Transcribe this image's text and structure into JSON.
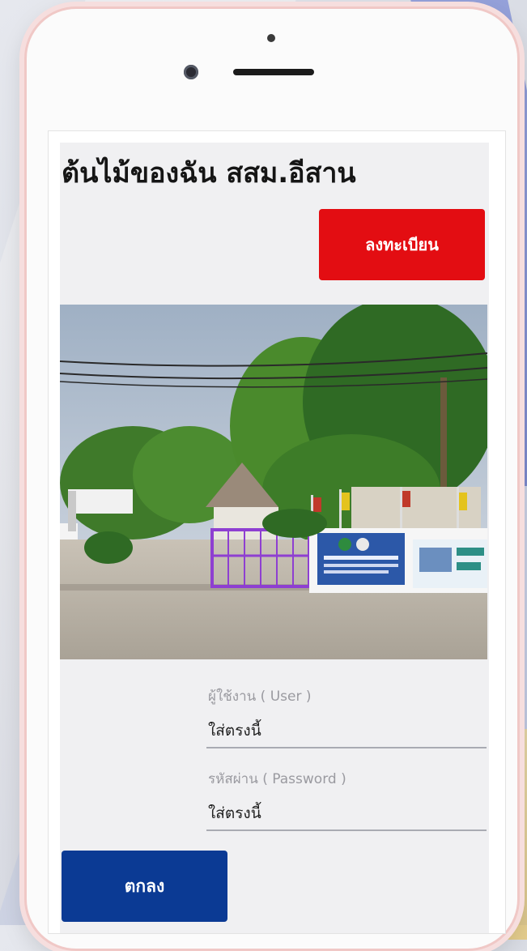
{
  "app": {
    "title": "ต้นไม้ของฉัน สสม.อีสาน"
  },
  "header": {
    "register_label": "ลงทะเบียน"
  },
  "hero_image": {
    "banner_text": "ศูนย์พัฒนาการสาธารณสุขมูลฐาน"
  },
  "login": {
    "user_label": "ผู้ใช้งาน ( User )",
    "user_placeholder": "ใส่ตรงนี้",
    "password_label": "รหัสผ่าน ( Password )",
    "password_placeholder": "ใส่ตรงนี้",
    "submit_label": "ตกลง"
  },
  "colors": {
    "register_button": "#e30d12",
    "submit_button": "#0b3a94",
    "phone_frame_border": "#f0c8c6",
    "content_background": "#f0f0f2"
  },
  "icons": {
    "camera": "front-camera-icon",
    "sensor": "sensor-dot-icon",
    "speaker": "speaker-grille-icon"
  }
}
